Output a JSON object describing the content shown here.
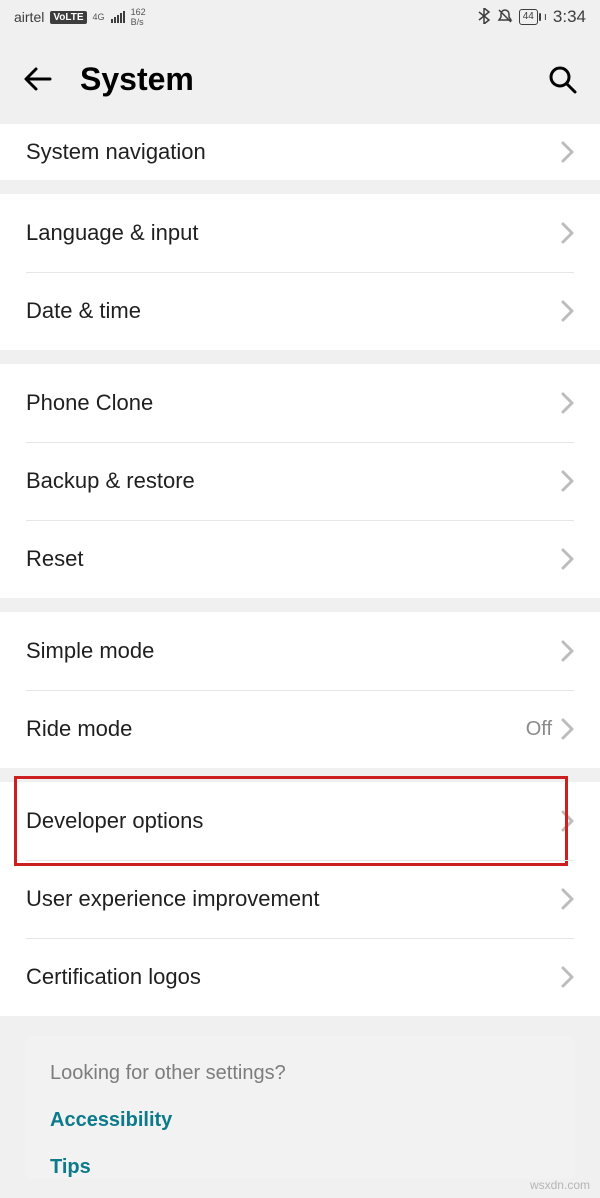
{
  "status": {
    "carrier": "airtel",
    "volte": "VoLTE",
    "net_top": "4G",
    "speed_top": "162",
    "speed_bottom": "B/s",
    "battery": "44",
    "time": "3:34"
  },
  "header": {
    "title": "System"
  },
  "groups": [
    {
      "rows": [
        {
          "label": "System navigation"
        }
      ],
      "first_short": true
    },
    {
      "rows": [
        {
          "label": "Language & input"
        },
        {
          "label": "Date & time"
        }
      ]
    },
    {
      "rows": [
        {
          "label": "Phone Clone"
        },
        {
          "label": "Backup & restore"
        },
        {
          "label": "Reset"
        }
      ]
    },
    {
      "rows": [
        {
          "label": "Simple mode"
        },
        {
          "label": "Ride mode",
          "value": "Off"
        }
      ]
    },
    {
      "rows": [
        {
          "label": "Developer options",
          "highlight": true
        },
        {
          "label": "User experience improvement"
        },
        {
          "label": "Certification logos"
        }
      ]
    }
  ],
  "footer": {
    "prompt": "Looking for other settings?",
    "links": [
      "Accessibility",
      "Tips"
    ]
  },
  "watermark": "wsxdn.com"
}
